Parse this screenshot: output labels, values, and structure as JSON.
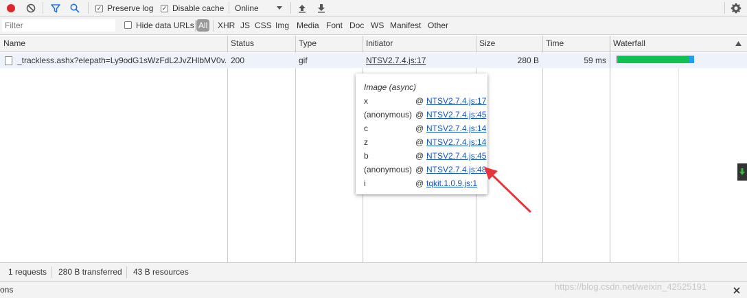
{
  "toolbar": {
    "record_icon": "record-icon",
    "clear_icon": "clear-icon",
    "filter_icon": "filter-icon",
    "search_icon": "search-icon",
    "preserve_log_label": "Preserve log",
    "preserve_log_checked": true,
    "disable_cache_label": "Disable cache",
    "disable_cache_checked": true,
    "throttling_value": "Online",
    "import_icon": "upload-icon",
    "export_icon": "download-icon",
    "settings_icon": "gear-icon"
  },
  "filterbar": {
    "filter_placeholder": "Filter",
    "hide_data_urls_label": "Hide data URLs",
    "types": [
      "All",
      "XHR",
      "JS",
      "CSS",
      "Img",
      "Media",
      "Font",
      "Doc",
      "WS",
      "Manifest",
      "Other"
    ]
  },
  "table": {
    "columns": [
      "Name",
      "Status",
      "Type",
      "Initiator",
      "Size",
      "Time",
      "Waterfall"
    ],
    "rows": [
      {
        "name": "_trackless.ashx?elepath=Ly9odG1sWzFdL2JvZHlbMV0v...",
        "status": "200",
        "type": "gif",
        "initiator": "NTSV2.7.4.js:17",
        "size": "280 B",
        "time": "59 ms"
      }
    ]
  },
  "popup": {
    "title": "Image (async)",
    "frames": [
      {
        "fn": "x",
        "at": "@",
        "link": "NTSV2.7.4.js:17"
      },
      {
        "fn": "(anonymous)",
        "at": "@",
        "link": "NTSV2.7.4.js:45"
      },
      {
        "fn": "c",
        "at": "@",
        "link": "NTSV2.7.4.js:14"
      },
      {
        "fn": "z",
        "at": "@",
        "link": "NTSV2.7.4.js:14"
      },
      {
        "fn": "b",
        "at": "@",
        "link": "NTSV2.7.4.js:45"
      },
      {
        "fn": "(anonymous)",
        "at": "@",
        "link": "NTSV2.7.4.js:48"
      },
      {
        "fn": "i",
        "at": "@",
        "link": "tqkit.1.0.9.js:1"
      }
    ]
  },
  "status_bar": {
    "requests": "1 requests",
    "transferred": "280 B transferred",
    "resources": "43 B resources"
  },
  "drawer": {
    "label": "ons",
    "close_icon": "close-icon"
  },
  "watermark": "https://blog.csdn.net/weixin_42525191",
  "colors": {
    "record": "#e0262a",
    "accent_blue": "#1a73e8",
    "waterfall_green": "#0cc14f",
    "waterfall_blue": "#1e9df7",
    "arrow_red": "#e8353a"
  }
}
